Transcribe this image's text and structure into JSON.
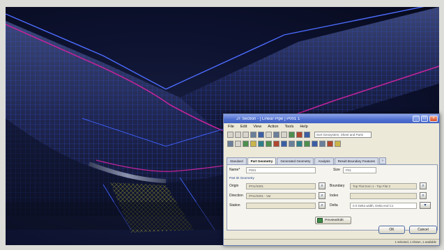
{
  "dialog": {
    "title": "JT Section - [ Linear Pipe ] P001 1",
    "menu": [
      "File",
      "Edit",
      "View",
      "Action",
      "Tools",
      "Help"
    ],
    "search_value": "Sort Geosystem, Sheet and Parts",
    "tabs": [
      "Standard",
      "Part Geometry",
      "Generated Geometry",
      "Analysis",
      "Result Boundary Features"
    ],
    "active_tab_index": 1,
    "name_label": "Name*",
    "name_value": "P001",
    "size_label": "Size",
    "size_value": "P01",
    "group_label": "Part ID Geometry",
    "origin_label": "Origin",
    "origin_value": "/P01/S001",
    "direction_label": "Direction",
    "direction_value": "/P01/S001 - Var",
    "station_label": "Station",
    "station_value": "",
    "boundary_label": "Boundary",
    "boundary_value": "Top Flat Dom 1 - Top Flat 2",
    "index_label": "Index",
    "index_value": "",
    "delta_label": "Delta",
    "delta_value": "0.0 Delta width, Delta end C1",
    "preview_label": "Preview/Edit",
    "ok_label": "OK",
    "cancel_label": "Cancel",
    "status_text": "1 selected, 1 shown, 1 available"
  },
  "colors": {
    "mesh_line": "#2f4fd8",
    "highlight_line": "#c0249a",
    "frame": "#dcdcd8"
  }
}
